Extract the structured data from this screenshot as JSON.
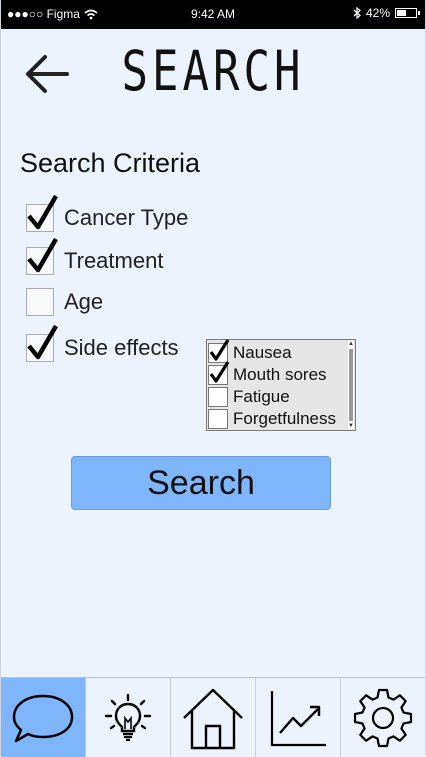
{
  "status_bar": {
    "carrier": "●●●○○ Figma",
    "time": "9:42 AM",
    "battery": "42%"
  },
  "header": {
    "title": "SEARCH"
  },
  "criteria": {
    "title": "Search Criteria",
    "items": [
      {
        "label": "Cancer Type",
        "checked": true
      },
      {
        "label": "Treatment",
        "checked": true
      },
      {
        "label": "Age",
        "checked": false
      },
      {
        "label": "Side effects",
        "checked": true
      }
    ]
  },
  "side_effects": {
    "options": [
      {
        "label": "Nausea",
        "checked": true
      },
      {
        "label": "Mouth sores",
        "checked": true
      },
      {
        "label": "Fatigue",
        "checked": false
      },
      {
        "label": "Forgetfulness",
        "checked": false
      }
    ]
  },
  "search_button": {
    "label": "Search"
  },
  "tab_bar": {
    "tabs": [
      {
        "icon": "chat-bubble-icon",
        "active": true
      },
      {
        "icon": "lightbulb-icon",
        "active": false
      },
      {
        "icon": "home-icon",
        "active": false
      },
      {
        "icon": "trend-chart-icon",
        "active": false
      },
      {
        "icon": "gear-icon",
        "active": false
      }
    ]
  },
  "colors": {
    "accent": "#7fb6fb",
    "background": "#edf3fd",
    "status_bar": "#000000"
  }
}
